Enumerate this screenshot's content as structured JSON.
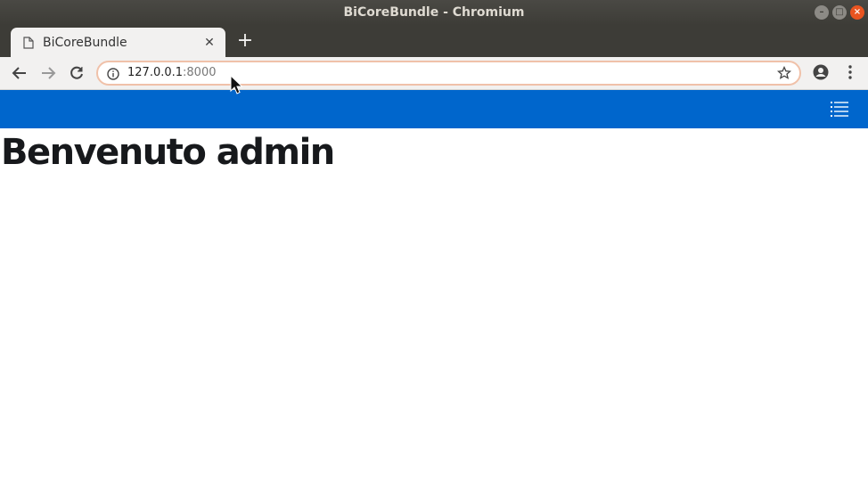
{
  "window": {
    "title": "BiCoreBundle - Chromium"
  },
  "tabs": [
    {
      "title": "BiCoreBundle"
    }
  ],
  "address_bar": {
    "host": "127.0.0.1",
    "port": ":8000"
  },
  "icons": {
    "back": "arrow-left-icon",
    "forward": "arrow-right-icon",
    "reload": "reload-icon",
    "info": "info-icon",
    "bookmark": "star-icon",
    "account": "account-icon",
    "menu": "kebab-menu-icon",
    "hamburger": "list-menu-icon"
  },
  "colors": {
    "navbar": "#0066cc",
    "title_text": "#17191c"
  },
  "page": {
    "heading": "Benvenuto admin"
  }
}
